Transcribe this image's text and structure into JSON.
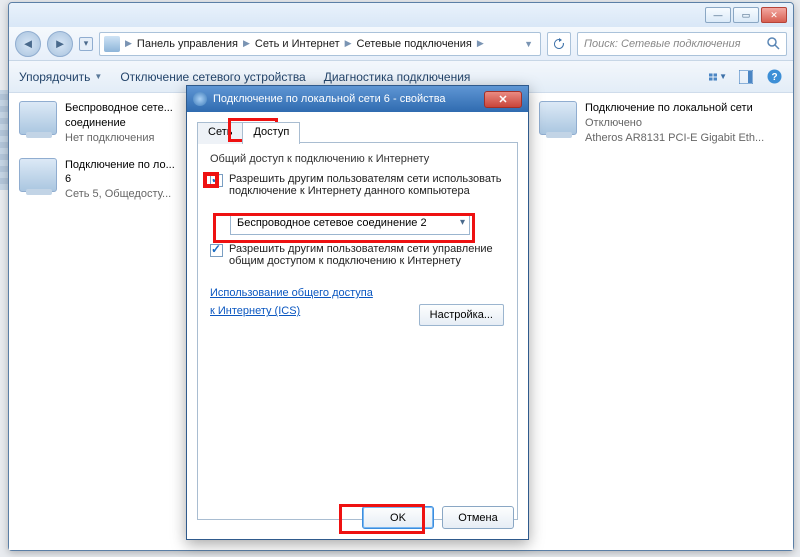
{
  "window": {
    "title": ""
  },
  "breadcrumb": {
    "items": [
      "Панель управления",
      "Сеть и Интернет",
      "Сетевые подключения"
    ]
  },
  "search": {
    "placeholder": "Поиск: Сетевые подключения"
  },
  "toolbar": {
    "organize": "Упорядочить",
    "disable": "Отключение сетевого устройства",
    "diagnose": "Диагностика подключения"
  },
  "connections": {
    "c1": {
      "title": "Беспроводное сете...",
      "line2": "соединение",
      "line3": "Нет подключения"
    },
    "c2": {
      "title": "Подключение по ло...",
      "line2": "6",
      "line3": "Сеть 5, Общедосту..."
    },
    "c3": {
      "title": "Подключение по локальной сети",
      "line2": "Отключено",
      "line3": "Atheros AR8131 PCI-E Gigabit Eth..."
    }
  },
  "dialog": {
    "title": "Подключение по локальной сети 6 - свойства",
    "tabs": {
      "network": "Сеть",
      "sharing": "Доступ"
    },
    "group": "Общий доступ к подключению к Интернету",
    "option1": "Разрешить другим пользователям сети использовать подключение к Интернету данного компьютера",
    "home_label": "",
    "dropdown_value": "Беспроводное сетевое соединение 2",
    "option2": "Разрешить другим пользователям сети управление общим доступом к подключению к Интернету",
    "link": "Использование общего доступа к Интернету (ICS)",
    "settings_btn": "Настройка...",
    "ok": "OK",
    "cancel": "Отмена"
  }
}
